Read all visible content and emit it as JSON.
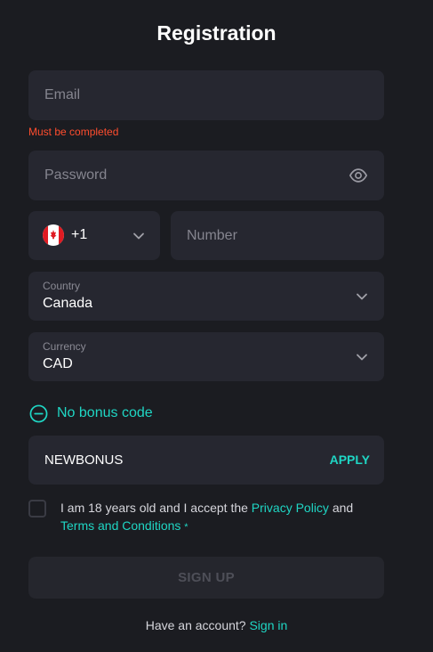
{
  "title": "Registration",
  "email": {
    "placeholder": "Email",
    "value": "",
    "error": "Must be completed"
  },
  "password": {
    "placeholder": "Password",
    "value": ""
  },
  "phone": {
    "code": "+1",
    "placeholder": "Number",
    "value": "",
    "flag_icon": "canada-flag-icon"
  },
  "country": {
    "label": "Country",
    "value": "Canada"
  },
  "currency": {
    "label": "Currency",
    "value": "CAD"
  },
  "bonus": {
    "toggle_label": "No bonus code",
    "code_value": "NEWBONUS",
    "apply_label": "APPLY"
  },
  "terms": {
    "text_before": "I am 18 years old and I accept the ",
    "privacy_link": "Privacy Policy",
    "and": " and",
    "terms_link": "Terms and Conditions",
    "required_mark": "*",
    "checked": false
  },
  "signup_label": "SIGN UP",
  "footer": {
    "question": "Have an account?",
    "signin_link": "Sign in"
  },
  "colors": {
    "background": "#1b1c21",
    "field": "#262730",
    "accent": "#1fd6c4",
    "error": "#ff4d2e",
    "flag_red": "#e01b22"
  }
}
